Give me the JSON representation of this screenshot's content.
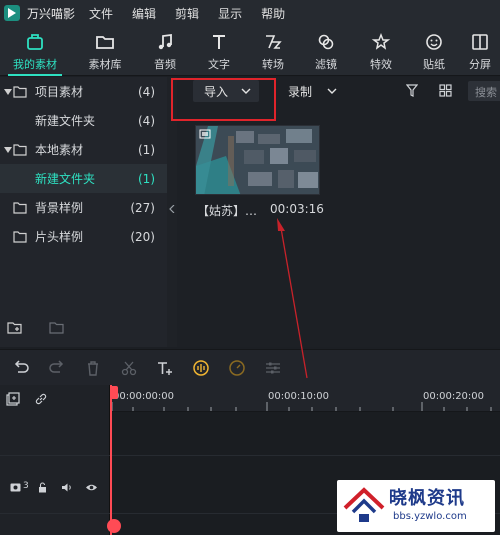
{
  "app": {
    "name": "万兴喵影",
    "menu": [
      "文件",
      "编辑",
      "剪辑",
      "显示",
      "帮助"
    ]
  },
  "toolbar": {
    "items": [
      {
        "label": "我的素材",
        "icon": "folder-box-icon",
        "active": true
      },
      {
        "label": "素材库",
        "icon": "folder-icon"
      },
      {
        "label": "音频",
        "icon": "music-note-icon"
      },
      {
        "label": "文字",
        "icon": "text-T-icon"
      },
      {
        "label": "转场",
        "icon": "transition-icon"
      },
      {
        "label": "滤镜",
        "icon": "filter-circles-icon"
      },
      {
        "label": "特效",
        "icon": "star-effect-icon"
      },
      {
        "label": "贴纸",
        "icon": "sticker-face-icon"
      },
      {
        "label": "分屏",
        "icon": "split-screen-icon"
      }
    ]
  },
  "library": {
    "items": [
      {
        "name": "项目素材",
        "count": "(4)"
      },
      {
        "name": "新建文件夹",
        "count": "(4)"
      },
      {
        "name": "本地素材",
        "count": "(1)"
      },
      {
        "name": "新建文件夹",
        "count": "(1)",
        "selected": true
      },
      {
        "name": "背景样例",
        "count": "(27)"
      },
      {
        "name": "片头样例",
        "count": "(20)"
      }
    ]
  },
  "media": {
    "import_label": "导入",
    "record_label": "录制",
    "search_placeholder": "搜索",
    "clip": {
      "name": "【姑苏】…",
      "duration": "00:03:16"
    }
  },
  "timeline": {
    "ruler": [
      "00:00:00:00",
      "00:00:10:00",
      "00:00:20:00"
    ],
    "track_label": "3"
  },
  "watermark": {
    "main": "晓枫资讯",
    "sub": "bbs.yzwlo.com"
  },
  "colors": {
    "accent": "#2ee0c1",
    "playhead": "#ff4b55",
    "highlight_box": "#e0242b",
    "annotation_arrow": "#c8222a"
  }
}
